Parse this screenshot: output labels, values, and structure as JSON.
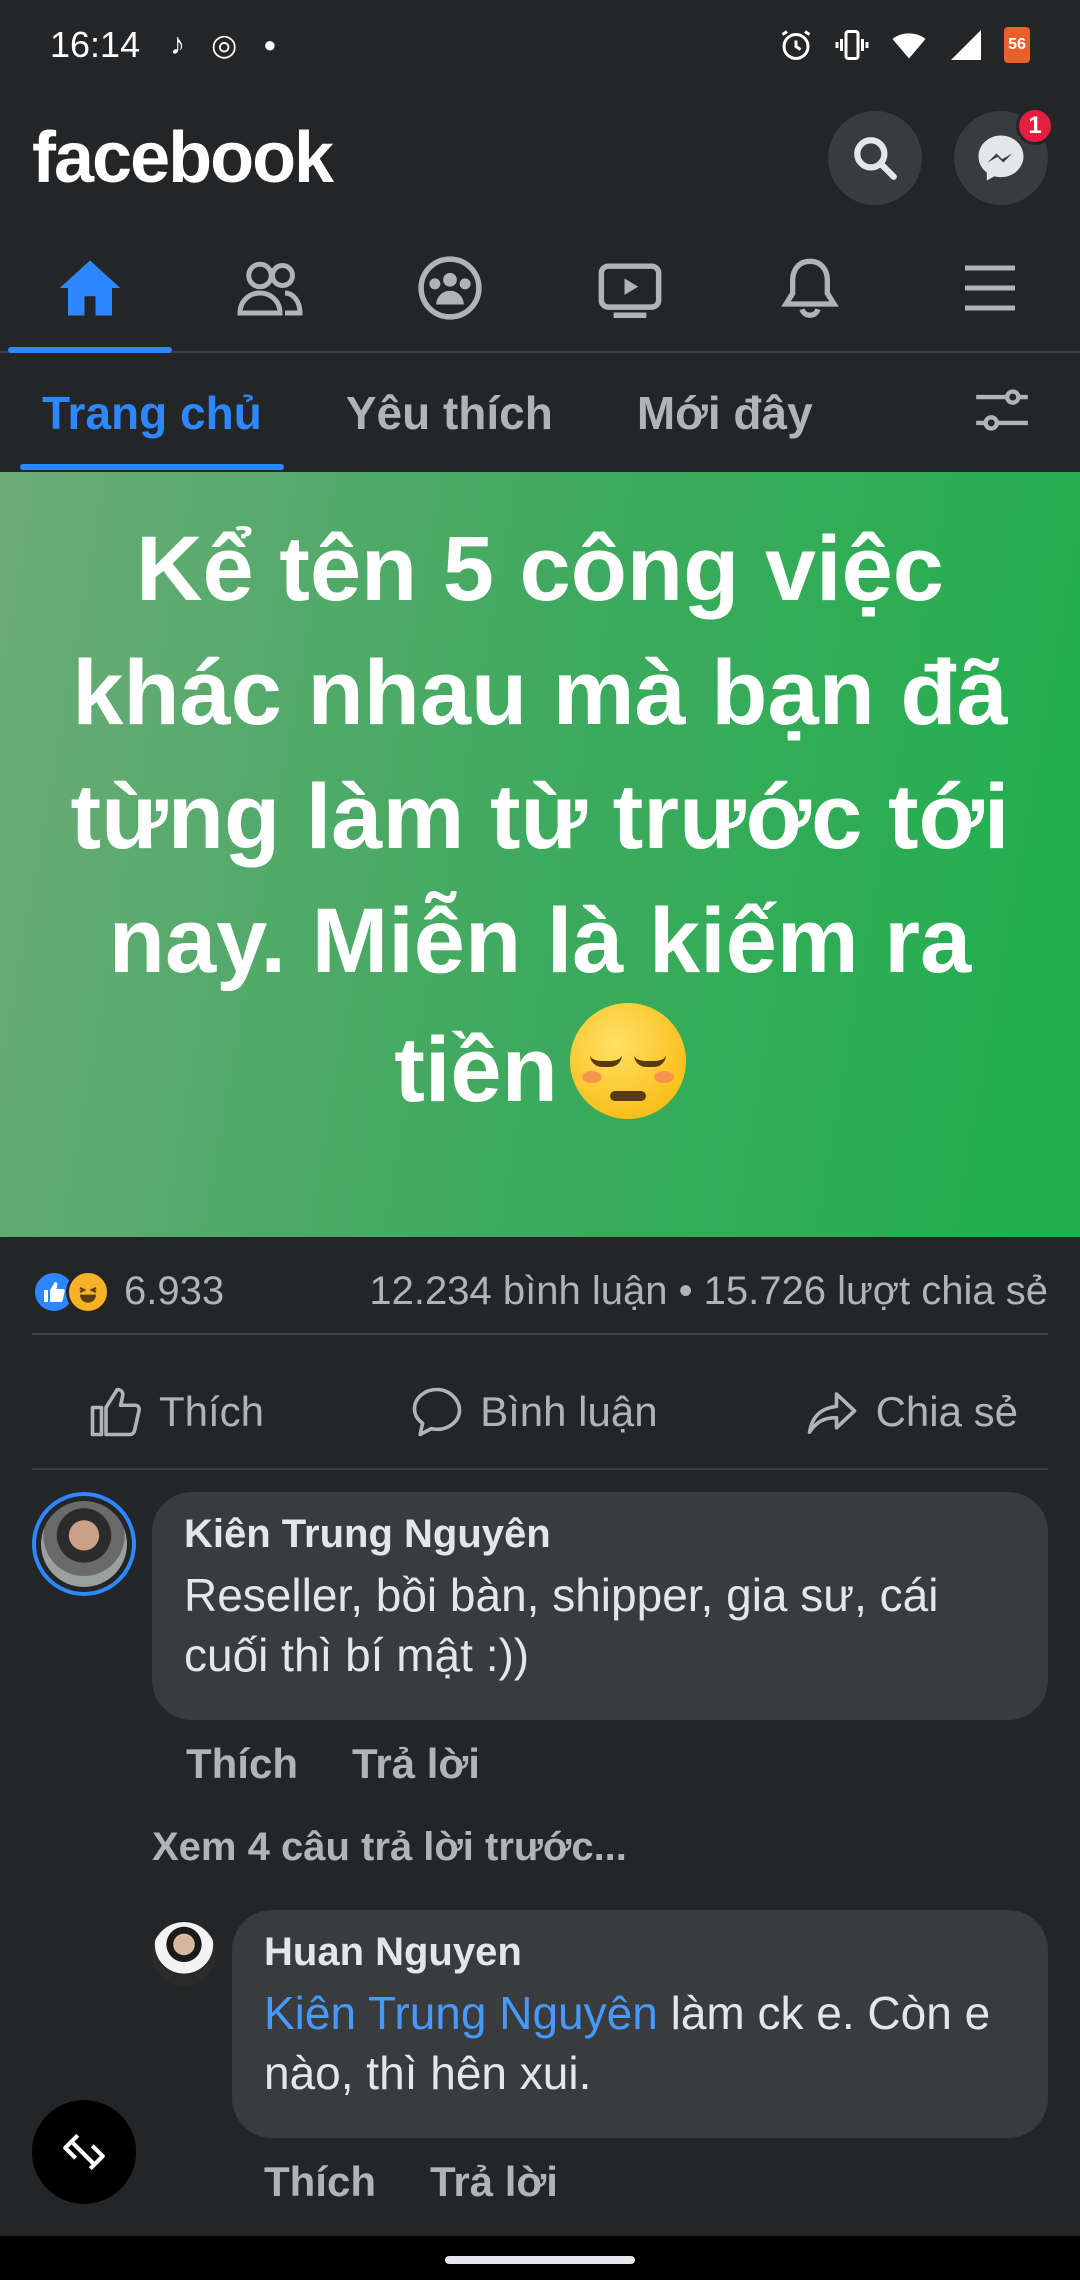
{
  "status_bar": {
    "time": "16:14",
    "battery": "56"
  },
  "header": {
    "logo": "facebook",
    "messenger_badge": "1"
  },
  "nav": {
    "items": [
      "home",
      "friends",
      "groups",
      "watch",
      "notifications",
      "menu"
    ],
    "active": "home"
  },
  "subtabs": {
    "items": [
      "Trang chủ",
      "Yêu thích",
      "Mới đây"
    ],
    "active": "Trang chủ"
  },
  "post": {
    "banner_text": "Kể tên 5 công việc khác nhau mà bạn đã từng làm từ trước tới nay. Miễn là kiếm ra tiền",
    "reactions_count": "6.933",
    "comments_shares": "12.234 bình luận • 15.726 lượt chia sẻ",
    "actions": {
      "like": "Thích",
      "comment": "Bình luận",
      "share": "Chia sẻ"
    }
  },
  "comments": [
    {
      "author": "Kiên Trung Nguyên",
      "text": "Reseller, bồi bàn, shipper, gia sư, cái cuối thì bí mật :))",
      "like": "Thích",
      "reply": "Trả lời"
    }
  ],
  "more_replies": "Xem 4 câu trả lời trước...",
  "reply": {
    "author": "Huan Nguyen",
    "mention": "Kiên Trung Nguyên",
    "text": " làm ck e. Còn e nào, thì hên xui.",
    "like": "Thích",
    "reply": "Trả lời"
  },
  "colors": {
    "accent": "#2d88ff",
    "background": "#242526",
    "bubble": "#3a3b3c",
    "banner_start": "#6cab78",
    "banner_end": "#1faf4d"
  }
}
